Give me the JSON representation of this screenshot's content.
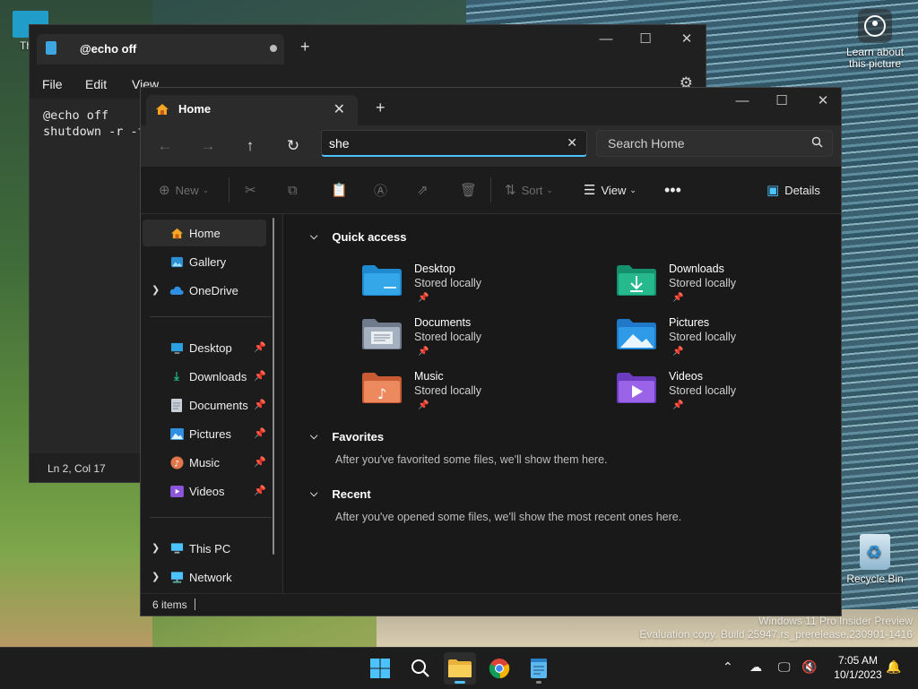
{
  "desktop": {
    "learn_icon_label": "Learn about this picture",
    "recycle_label": "Recycle Bin",
    "partial_icon_label": "Th",
    "watermark_line1": "Windows 11 Pro Insider Preview",
    "watermark_line2": "Evaluation copy. Build 25947.rs_prerelease.230901-1416"
  },
  "notepad": {
    "tab_title": "@echo off",
    "menu": [
      "File",
      "Edit",
      "View"
    ],
    "content": "@echo off\nshutdown -r -t",
    "status": "Ln 2, Col 17"
  },
  "explorer": {
    "tab_title": "Home",
    "address_value": "she",
    "search_placeholder": "Search Home",
    "commands": {
      "new": "New",
      "sort": "Sort",
      "view": "View",
      "details": "Details"
    },
    "nav": {
      "home": "Home",
      "gallery": "Gallery",
      "onedrive": "OneDrive",
      "desktop": "Desktop",
      "downloads": "Downloads",
      "documents": "Documents",
      "pictures": "Pictures",
      "music": "Music",
      "videos": "Videos",
      "thispc": "This PC",
      "network": "Network"
    },
    "sections": {
      "quick_access": "Quick access",
      "favorites": "Favorites",
      "favorites_empty": "After you've favorited some files, we'll show them here.",
      "recent": "Recent",
      "recent_empty": "After you've opened some files, we'll show the most recent ones here."
    },
    "quick_access": [
      {
        "name": "Desktop",
        "sub": "Stored locally",
        "color": "#2b9fe0"
      },
      {
        "name": "Downloads",
        "sub": "Stored locally",
        "color": "#21b38a"
      },
      {
        "name": "Documents",
        "sub": "Stored locally",
        "color": "#8e9aaa"
      },
      {
        "name": "Pictures",
        "sub": "Stored locally",
        "color": "#2f8fe0"
      },
      {
        "name": "Music",
        "sub": "Stored locally",
        "color": "#e0744a"
      },
      {
        "name": "Videos",
        "sub": "Stored locally",
        "color": "#8a55d8"
      }
    ],
    "status": "6 items"
  },
  "taskbar": {
    "clock_time": "7:05 AM",
    "clock_date": "10/1/2023"
  },
  "colors": {
    "accent": "#4cc2ff"
  }
}
